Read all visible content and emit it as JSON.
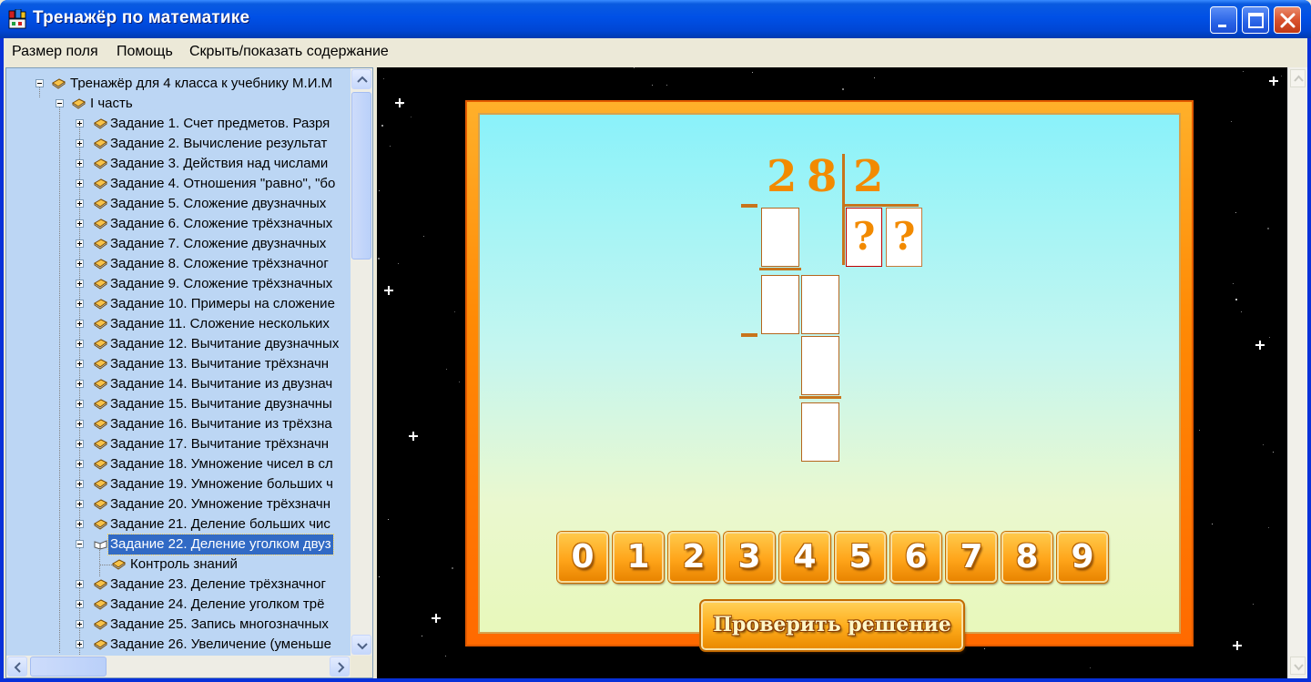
{
  "window": {
    "title": "Тренажёр по математике"
  },
  "menu": {
    "items": [
      "Размер поля",
      "Помощь",
      "Скрыть/показать содержание"
    ]
  },
  "tree": {
    "root": "Тренажёр для 4 класса к учебнику М.И.М",
    "part": "I часть",
    "tasks": [
      "Задание 1. Счет предметов. Разря",
      "Задание 2. Вычисление результат",
      "Задание 3. Действия над числами",
      "Задание 4. Отношения \"равно\", \"бо",
      "Задание 5. Сложение двузначных",
      "Задание 6. Сложение трёхзначных",
      "Задание 7. Сложение двузначных",
      "Задание 8. Сложение трёхзначног",
      "Задание 9. Сложение трёхзначных",
      "Задание 10. Примеры на сложение",
      "Задание 11. Сложение нескольких",
      "Задание 12. Вычитание двузначных",
      "Задание 13. Вычитание трёхзначн",
      "Задание 14. Вычитание из двузнач",
      "Задание 15. Вычитание двузначны",
      "Задание 16. Вычитание из трёхзна",
      "Задание 17. Вычитание трёхзначн",
      "Задание 18. Умножение чисел в сл",
      "Задание 19. Умножение больших ч",
      "Задание 20. Умножение трёхзначн",
      "Задание 21. Деление больших чис",
      "Задание 22. Деление уголком двуз"
    ],
    "subitem": "Контроль знаний",
    "tasks_after": [
      "Задание 23. Деление трёхзначног",
      "Задание 24. Деление уголком трё",
      "Задание 25. Запись многозначных",
      "Задание 26. Увеличение (уменьше"
    ],
    "selected_index": 21
  },
  "exercise": {
    "dividend_digits": [
      "2",
      "8"
    ],
    "divisor": "2",
    "quotient_placeholders": [
      "?",
      "?"
    ],
    "keypad": [
      "0",
      "1",
      "2",
      "3",
      "4",
      "5",
      "6",
      "7",
      "8",
      "9"
    ],
    "check_label": "Проверить решение"
  },
  "colors": {
    "titlebar": "#0050e6",
    "selection": "#316ac5",
    "tree_bg": "#bcd6f4",
    "accent_orange": "#f28a00"
  },
  "icons": [
    "app-icon",
    "minimize-icon",
    "maximize-icon",
    "close-icon",
    "book-icon",
    "open-book-icon",
    "expander-icon"
  ]
}
